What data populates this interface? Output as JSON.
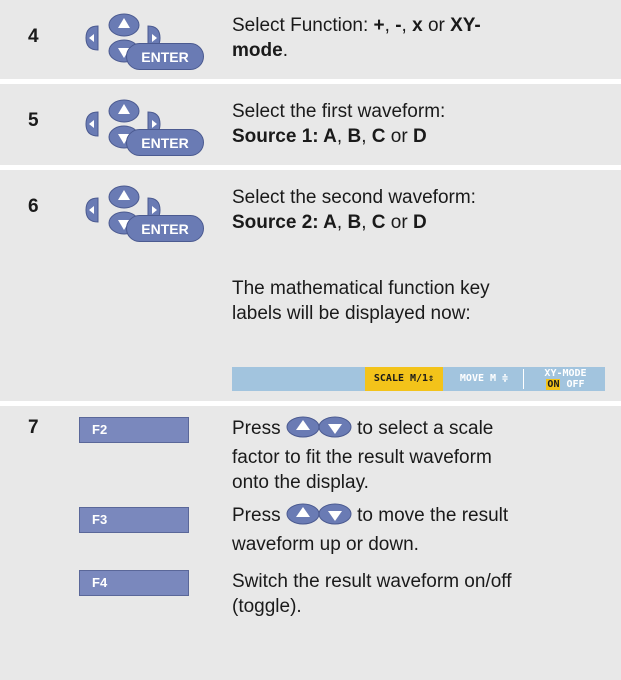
{
  "enter_label": "ENTER",
  "steps": [
    {
      "number": "4",
      "lines": [
        [
          {
            "t": "Select Function: ",
            "b": false
          },
          {
            "t": "+",
            "b": true
          },
          {
            "t": ", ",
            "b": false
          },
          {
            "t": "-",
            "b": true
          },
          {
            "t": ", ",
            "b": false
          },
          {
            "t": "x",
            "b": true
          },
          {
            "t": " or ",
            "b": false
          },
          {
            "t": "XY-",
            "b": true
          }
        ],
        [
          {
            "t": "mode",
            "b": true
          },
          {
            "t": ".",
            "b": false
          }
        ]
      ]
    },
    {
      "number": "5",
      "lines": [
        [
          {
            "t": "Select the first waveform:",
            "b": false
          }
        ],
        [
          {
            "t": "Source 1: A",
            "b": true
          },
          {
            "t": ", ",
            "b": false
          },
          {
            "t": "B",
            "b": true
          },
          {
            "t": ", ",
            "b": false
          },
          {
            "t": "C",
            "b": true
          },
          {
            "t": " or ",
            "b": false
          },
          {
            "t": "D",
            "b": true
          }
        ]
      ]
    },
    {
      "number": "6",
      "lines": [
        [
          {
            "t": "Select the second waveform:",
            "b": false
          }
        ],
        [
          {
            "t": "Source 2: A",
            "b": true
          },
          {
            "t": ", ",
            "b": false
          },
          {
            "t": "B",
            "b": true
          },
          {
            "t": ", ",
            "b": false
          },
          {
            "t": "C",
            "b": true
          },
          {
            "t": " or ",
            "b": false
          },
          {
            "t": "D",
            "b": true
          }
        ]
      ]
    }
  ],
  "step6_note": {
    "line1": "The mathematical function key",
    "line2": "labels will be displayed now:"
  },
  "softkeys": {
    "scale": "SCALE M/1",
    "scale_arrows": "⇕",
    "move": "MOVE M ≑",
    "xy_line1": "XY-MODE",
    "xy_on": "ON",
    "xy_off": "OFF"
  },
  "step7": {
    "number": "7",
    "f2": {
      "key": "F2",
      "press": "Press",
      "after": "to select a scale",
      "line2": "factor to fit the result waveform",
      "line3": "onto the display."
    },
    "f3": {
      "key": "F3",
      "press": "Press",
      "after": "to move the result",
      "line2": "waveform up or down."
    },
    "f4": {
      "key": "F4",
      "line1": "Switch the result waveform on/off",
      "line2": "(toggle)."
    }
  },
  "colors": {
    "row_bg": "#e8e8e8",
    "key_blue": "#6a7bb4",
    "softbar_bg": "#a2c4de",
    "softkey_highlight": "#f3c31a"
  }
}
